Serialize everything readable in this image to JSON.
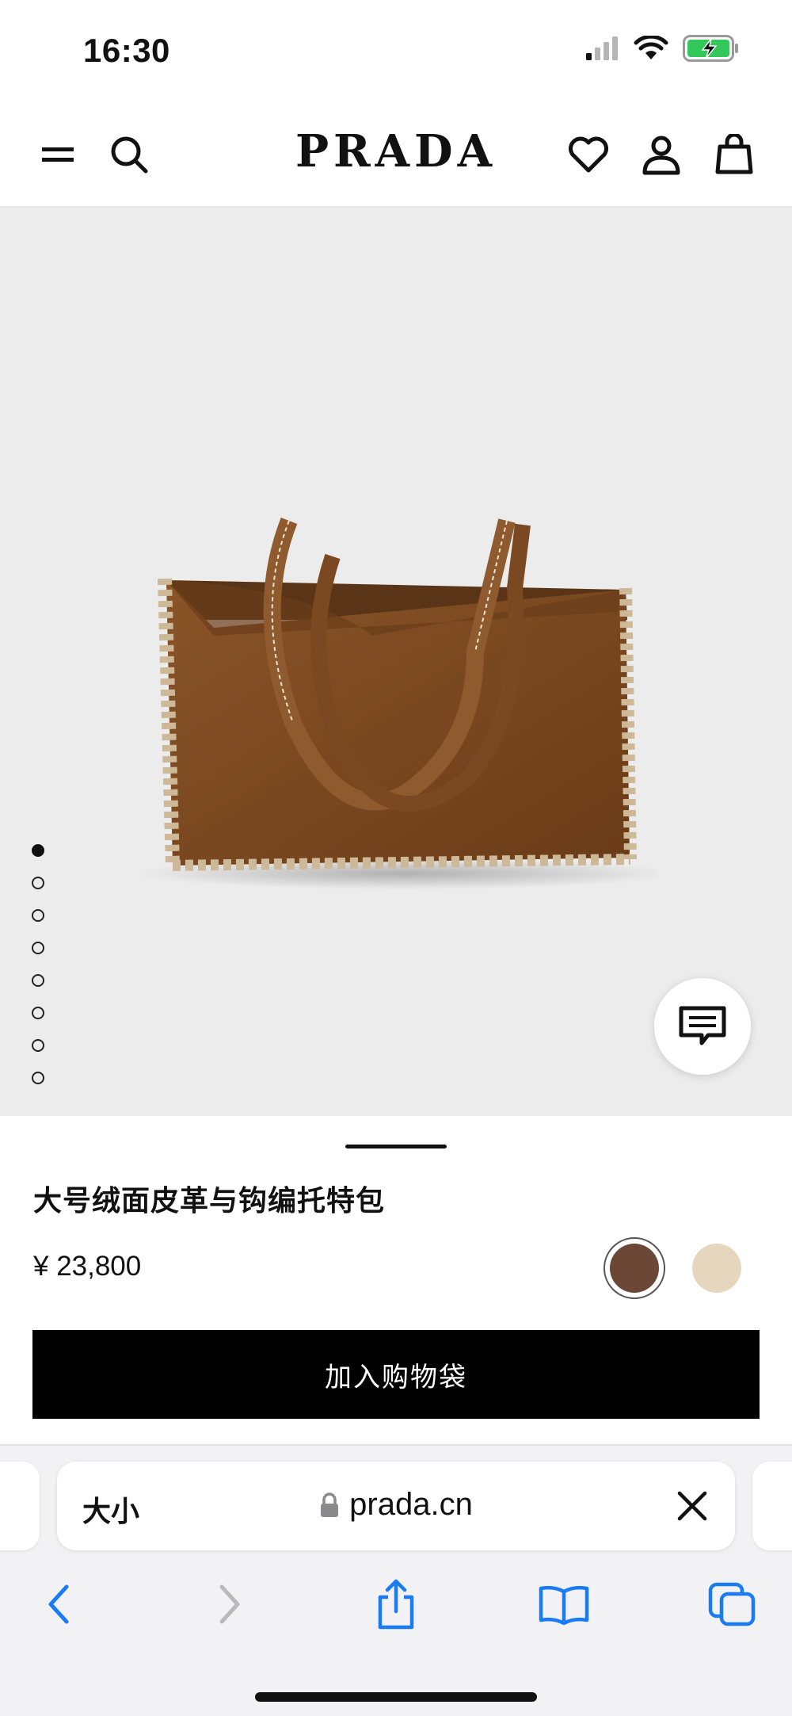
{
  "status_bar": {
    "time": "16:30",
    "icons": [
      "cellular-signal-icon",
      "wifi-icon",
      "battery-charging-icon"
    ]
  },
  "header": {
    "brand": "PRADA",
    "left_icons": [
      "menu-icon",
      "search-icon"
    ],
    "right_icons": [
      "heart-icon",
      "account-icon",
      "shopping-bag-icon"
    ]
  },
  "gallery": {
    "image_count": 8,
    "active_index": 0,
    "chat_icon": "chat-icon"
  },
  "product": {
    "name": "大号绒面皮革与钩编托特包",
    "price": "¥ 23,800",
    "swatches": [
      {
        "color": "#6b4735",
        "selected": true
      },
      {
        "color": "#e6d6bd",
        "selected": false
      }
    ],
    "add_to_bag_label": "加入购物袋"
  },
  "browser": {
    "text_size_label": "大小",
    "url": "prada.cn",
    "toolbar": [
      "back-icon",
      "forward-icon",
      "share-icon",
      "bookmarks-icon",
      "tabs-icon"
    ],
    "accent": "#1a7cf5"
  }
}
